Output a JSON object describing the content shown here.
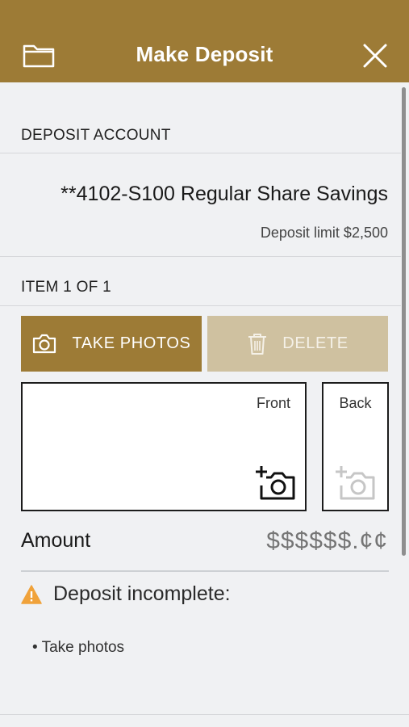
{
  "header": {
    "title": "Make Deposit",
    "left_icon": "folder-icon",
    "right_icon": "close-icon"
  },
  "deposit_account": {
    "label": "DEPOSIT ACCOUNT",
    "account_name": "**4102-S100 Regular Share Savings",
    "limit_text": "Deposit limit $2,500"
  },
  "item": {
    "label": "ITEM 1 OF 1",
    "take_photos_label": "TAKE PHOTOS",
    "delete_label": "DELETE",
    "front_label": "Front",
    "back_label": "Back"
  },
  "amount": {
    "label": "Amount",
    "placeholder": "$$$$$$.¢¢",
    "value": ""
  },
  "status": {
    "message": "Deposit incomplete:",
    "items": [
      "• Take photos"
    ]
  },
  "colors": {
    "accent": "#9d7b36",
    "accent_disabled": "#cfc1a0",
    "background": "#f0f1f3",
    "warning": "#f0a23a"
  }
}
